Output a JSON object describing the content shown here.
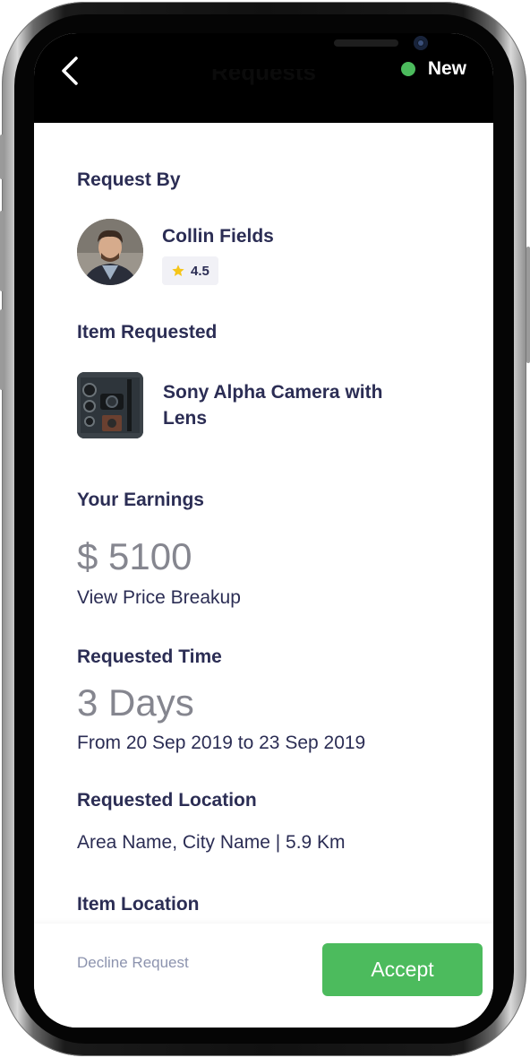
{
  "header": {
    "title": "Requests",
    "status_label": "New",
    "status_color": "#4cbb5d",
    "back_icon": "chevron-left-icon"
  },
  "request_by": {
    "section_title": "Request By",
    "name": "Collin Fields",
    "rating": "4.5",
    "rating_icon": "star-icon",
    "star_color": "#f5c518"
  },
  "item": {
    "section_title": "Item Requested",
    "name": "Sony Alpha Camera with Lens"
  },
  "earnings": {
    "section_title": "Your Earnings",
    "amount": "$ 5100",
    "link": "View Price Breakup"
  },
  "requested_time": {
    "section_title": "Requested Time",
    "duration": "3 Days",
    "range": "From 20 Sep 2019 to 23 Sep 2019"
  },
  "requested_location": {
    "section_title": "Requested Location",
    "value": "Area Name, City Name | 5.9 Km"
  },
  "item_location": {
    "section_title": "Item Location"
  },
  "footer": {
    "decline_label": "Decline Request",
    "accept_label": "Accept",
    "accept_color": "#4cbb5d"
  }
}
